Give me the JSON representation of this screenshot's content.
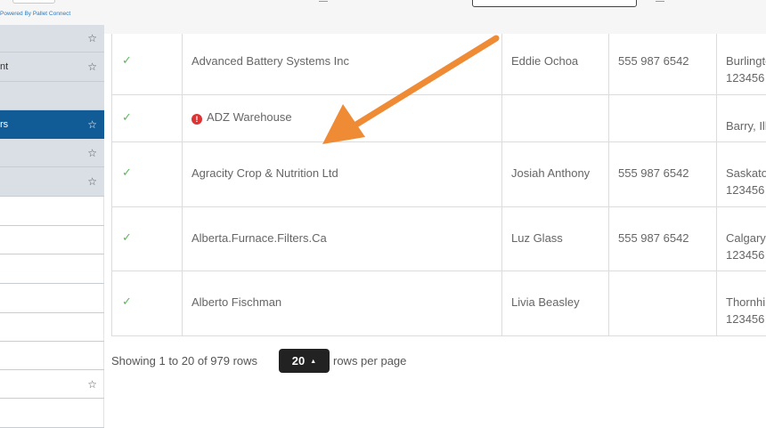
{
  "header": {
    "powered_by": "Powered By Pallet Connect"
  },
  "sidebar": {
    "items": [
      {
        "label": "",
        "starred": true,
        "state": "gray"
      },
      {
        "label": "nt",
        "starred": true,
        "state": "gray"
      },
      {
        "label": "",
        "starred": false,
        "state": "gray"
      },
      {
        "label": "rs",
        "starred": true,
        "state": "active"
      },
      {
        "label": "",
        "starred": true,
        "state": "gray"
      },
      {
        "label": "",
        "starred": true,
        "state": "gray"
      },
      {
        "label": "",
        "starred": false,
        "state": "plain"
      },
      {
        "label": "",
        "starred": false,
        "state": "plain"
      },
      {
        "label": "",
        "starred": false,
        "state": "plain"
      },
      {
        "label": "",
        "starred": false,
        "state": "plain"
      },
      {
        "label": "",
        "starred": false,
        "state": "plain"
      },
      {
        "label": "",
        "starred": false,
        "state": "plain"
      },
      {
        "label": "",
        "starred": true,
        "state": "plain"
      },
      {
        "label": "",
        "starred": false,
        "state": "plain"
      }
    ]
  },
  "icons": {
    "star": "star-outline-icon",
    "check": "check-icon",
    "warning": "exclamation-circle-icon",
    "caret": "caret-up-icon"
  },
  "colors": {
    "sidebar_active": "#115b97",
    "check_green": "#5cb85c",
    "warning_red": "#d33333",
    "arrow_orange": "#ef8a35"
  },
  "table": {
    "rows": [
      {
        "status": "✓",
        "name": "Advanced Battery Systems Inc",
        "warning": false,
        "contact": "Eddie Ochoa",
        "phone": "555 987 6542",
        "address1": "Burlingto",
        "address2": "123456"
      },
      {
        "status": "✓",
        "name": "ADZ Warehouse",
        "warning": true,
        "contact": "",
        "phone": "",
        "address1": "",
        "address2": "Barry, Illi"
      },
      {
        "status": "✓",
        "name": "Agracity Crop & Nutrition Ltd",
        "warning": false,
        "contact": "Josiah Anthony",
        "phone": "555 987 6542",
        "address1": "Saskatoo",
        "address2": "123456"
      },
      {
        "status": "✓",
        "name": "Alberta.Furnace.Filters.Ca",
        "warning": false,
        "contact": "Luz Glass",
        "phone": "555 987 6542",
        "address1": "Calgary",
        "address2": "123456"
      },
      {
        "status": "✓",
        "name": "Alberto Fischman",
        "warning": false,
        "contact": "Livia Beasley",
        "phone": "",
        "address1": "Thornhill",
        "address2": "123456"
      }
    ]
  },
  "pager": {
    "info": "Showing 1 to 20 of 979 rows",
    "page_size": "20",
    "suffix": "rows per page"
  }
}
